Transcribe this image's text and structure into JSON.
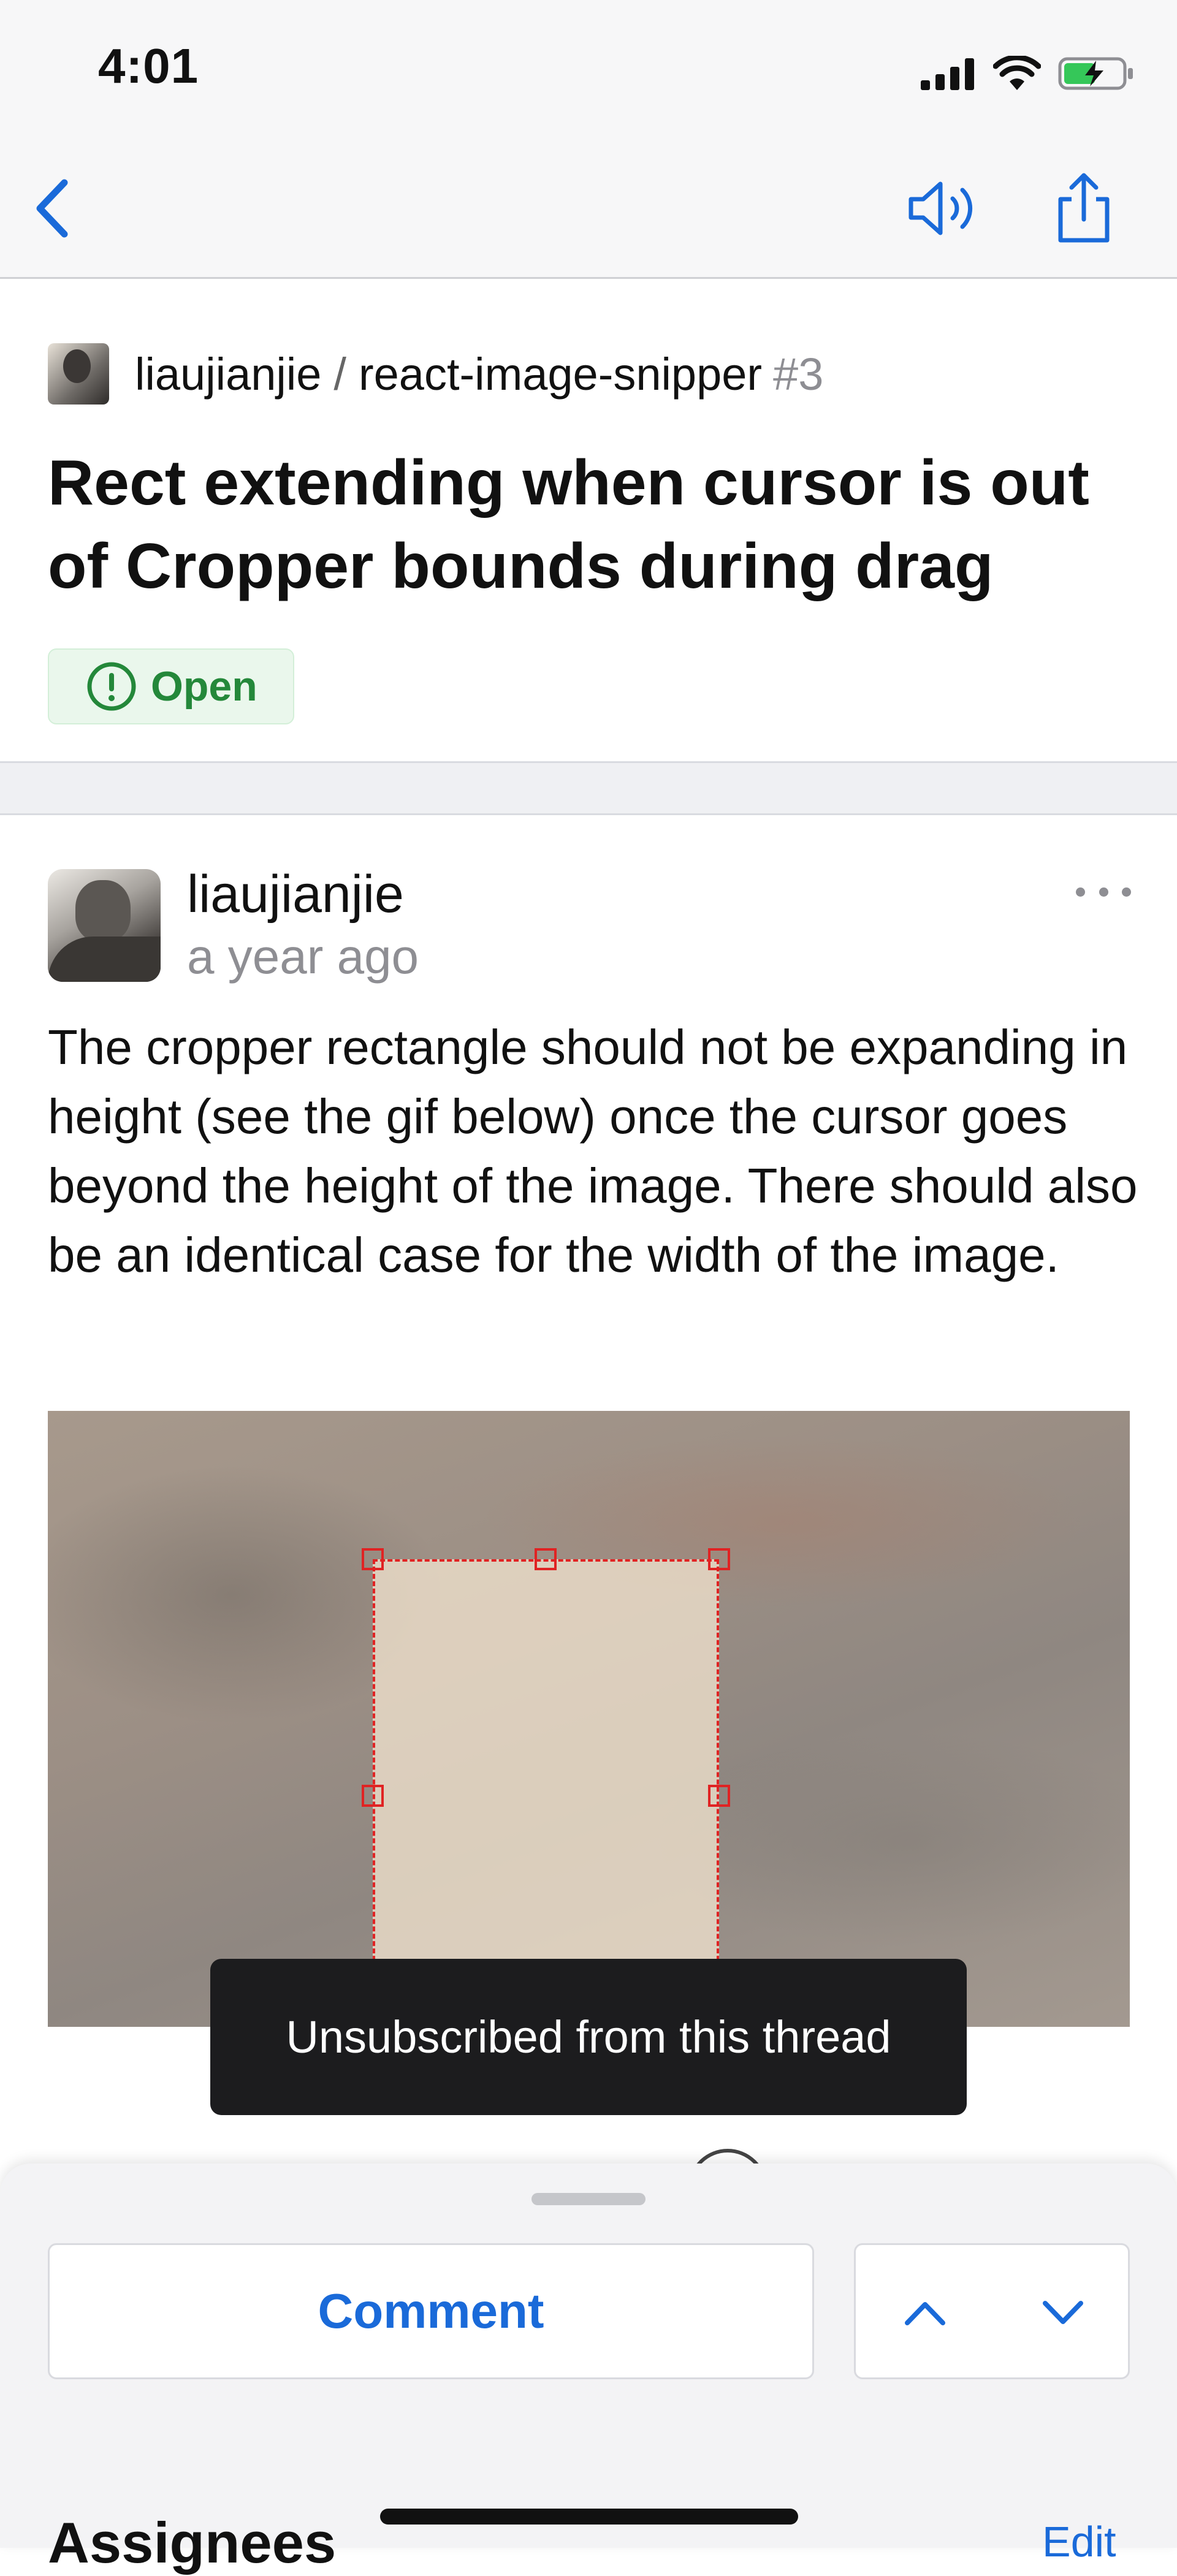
{
  "status_bar": {
    "time": "4:01",
    "icons": [
      "cellular-signal-icon",
      "wifi-icon",
      "battery-charging-icon"
    ]
  },
  "nav_bar": {
    "icons": [
      "back-chevron-icon",
      "speaker-icon",
      "share-icon"
    ],
    "accent_color": "#1a6ad9"
  },
  "issue": {
    "owner": "liaujianjie",
    "separator": "/",
    "repo": "react-image-snipper",
    "number": "#3",
    "title": "Rect extending when cursor is out of Cropper bounds during drag",
    "state": "Open",
    "state_color": "#24883a"
  },
  "comment": {
    "author": "liaujianjie",
    "time": "a year ago",
    "body": "The cropper rectangle should not be expanding in height (see the gif below) once the cursor goes beyond the height of the image. There should also be an identical case for the width of the image."
  },
  "toast": {
    "message": "Unsubscribed from this thread"
  },
  "bottom_sheet": {
    "comment_label": "Comment",
    "assignees_label": "Assignees",
    "edit_label": "Edit"
  }
}
